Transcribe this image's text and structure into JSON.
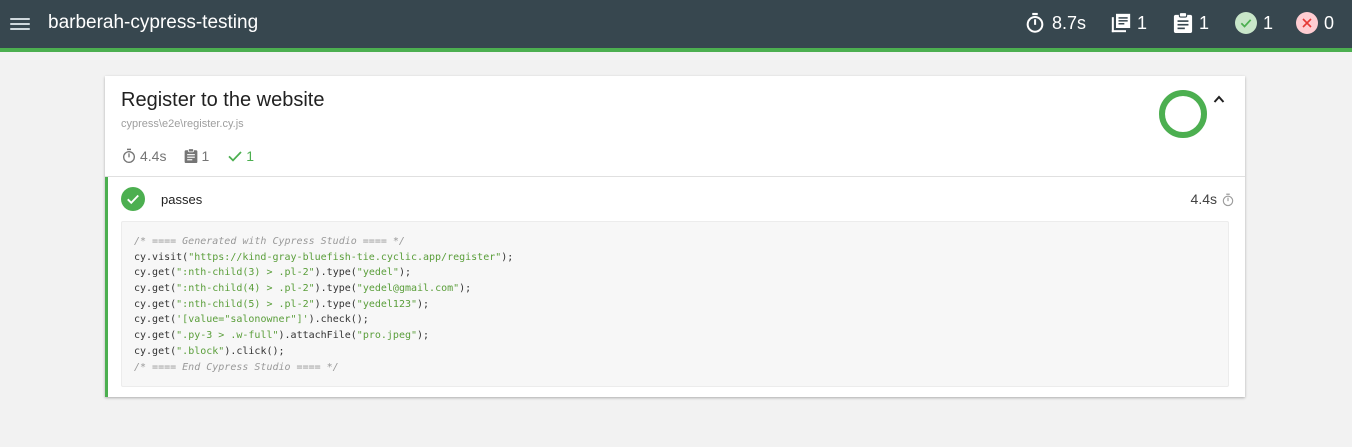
{
  "header": {
    "title": "barberah-cypress-testing",
    "stats": {
      "duration": "8.7s",
      "suites": "1",
      "tests": "1",
      "passed": "1",
      "failed": "0"
    },
    "colors": {
      "bar": "#37474f",
      "accent": "#4caf50"
    }
  },
  "suite": {
    "title": "Register to the website",
    "file": "cypress\\e2e\\register.cy.js",
    "stats": {
      "duration": "4.4s",
      "tests": "1",
      "passed": "1"
    },
    "pass_fraction": 1.0,
    "test": {
      "title": "passes",
      "duration": "4.4s",
      "status": "passed",
      "code": [
        [
          [
            "c-com",
            "/* ==== Generated with Cypress Studio ==== */"
          ]
        ],
        [
          [
            "c-pl",
            "cy.visit("
          ],
          [
            "c-str",
            "\"https://kind-gray-bluefish-tie.cyclic.app/register\""
          ],
          [
            "c-pl",
            ");"
          ]
        ],
        [
          [
            "c-pl",
            "cy.get("
          ],
          [
            "c-str",
            "\":nth-child(3) > .pl-2\""
          ],
          [
            "c-pl",
            ").type("
          ],
          [
            "c-str",
            "\"yedel\""
          ],
          [
            "c-pl",
            ");"
          ]
        ],
        [
          [
            "c-pl",
            "cy.get("
          ],
          [
            "c-str",
            "\":nth-child(4) > .pl-2\""
          ],
          [
            "c-pl",
            ").type("
          ],
          [
            "c-str",
            "\"yedel@gmail.com\""
          ],
          [
            "c-pl",
            ");"
          ]
        ],
        [
          [
            "c-pl",
            "cy.get("
          ],
          [
            "c-str",
            "\":nth-child(5) > .pl-2\""
          ],
          [
            "c-pl",
            ").type("
          ],
          [
            "c-str",
            "\"yedel123\""
          ],
          [
            "c-pl",
            ");"
          ]
        ],
        [
          [
            "c-pl",
            "cy.get("
          ],
          [
            "c-str",
            "'[value=\"salonowner\"]'"
          ],
          [
            "c-pl",
            ").check();"
          ]
        ],
        [
          [
            "c-pl",
            "cy.get("
          ],
          [
            "c-str",
            "\".py-3 > .w-full\""
          ],
          [
            "c-pl",
            ").attachFile("
          ],
          [
            "c-str",
            "\"pro.jpeg\""
          ],
          [
            "c-pl",
            ");"
          ]
        ],
        [
          [
            "c-pl",
            "cy.get("
          ],
          [
            "c-str",
            "\".block\""
          ],
          [
            "c-pl",
            ").click();"
          ]
        ],
        [
          [
            "c-com",
            "/* ==== End Cypress Studio ==== */"
          ]
        ]
      ]
    }
  },
  "icons": {
    "menu": "menu-icon",
    "timer": "stopwatch-icon",
    "suites": "library-books-icon",
    "tests": "clipboard-icon",
    "passed": "check-circle-icon",
    "failed": "close-circle-icon",
    "collapse": "chevron-up-icon"
  }
}
